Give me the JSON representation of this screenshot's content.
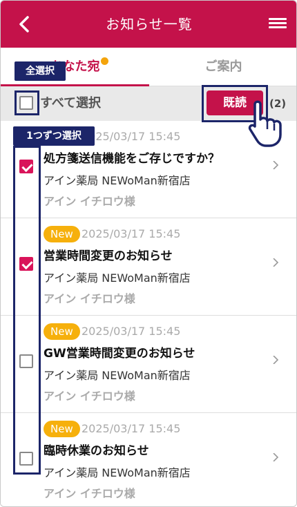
{
  "header": {
    "title": "お知らせ一覧",
    "back_icon": "chevron-left-icon",
    "menu_icon": "hamburger-menu-icon",
    "color": "#c4124a"
  },
  "tabs": [
    {
      "label": "あなた宛",
      "active": true,
      "has_unread_dot": true
    },
    {
      "label": "ご案内",
      "active": false
    }
  ],
  "select_bar": {
    "select_all_label": "すべて選択",
    "read_button_label": "既読",
    "selected_count": "(2)"
  },
  "annotations": {
    "select_all": "全選択",
    "select_each": "1つずつ選択"
  },
  "notifications": [
    {
      "is_new": false,
      "badge": "",
      "date": "2025/03/17 15:45",
      "subject": "処方箋送信機能をご存じですか？",
      "store": "アイン薬局 NEWoMan新宿店",
      "user": "アイン イチロウ様",
      "checked": true
    },
    {
      "is_new": true,
      "badge": "New",
      "date": "2025/03/17 15:45",
      "subject": "営業時間変更のお知らせ",
      "store": "アイン薬局 NEWoMan新宿店",
      "user": "アイン イチロウ様",
      "checked": true
    },
    {
      "is_new": true,
      "badge": "New",
      "date": "2025/03/17 15:45",
      "subject": "GW営業時間変更のお知らせ",
      "store": "アイン薬局 NEWoMan新宿店",
      "user": "アイン イチロウ様",
      "checked": false
    },
    {
      "is_new": true,
      "badge": "New",
      "date": "2025/03/17 15:45",
      "subject": "臨時休業のお知らせ",
      "store": "アイン薬局 NEWoMan新宿店",
      "user": "アイン イチロウ様",
      "checked": false
    }
  ]
}
